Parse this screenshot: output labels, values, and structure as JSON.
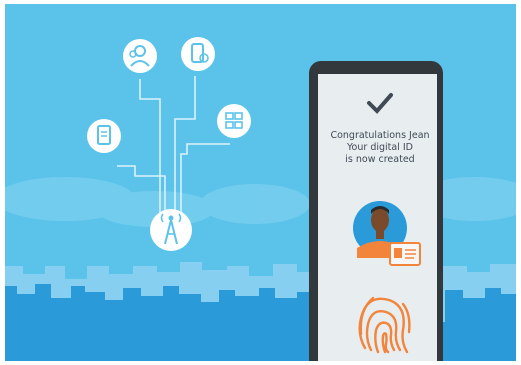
{
  "phone": {
    "line1": "Congratulations Jean",
    "line2": "Your digital ID",
    "line3": "is now created"
  },
  "icons": [
    "user-group-icon",
    "document-phone-icon",
    "id-card-icon",
    "building-grid-icon",
    "signal-tower-icon",
    "checkmark-icon",
    "person-avatar-icon",
    "fingerprint-icon"
  ],
  "colors": {
    "sky": "#5bc3ea",
    "skyline_light": "#86cff0",
    "skyline_dark": "#2a9ad8",
    "phone_frame": "#33383d",
    "phone_screen": "#e8edf0",
    "accent_orange": "#f2843c"
  }
}
